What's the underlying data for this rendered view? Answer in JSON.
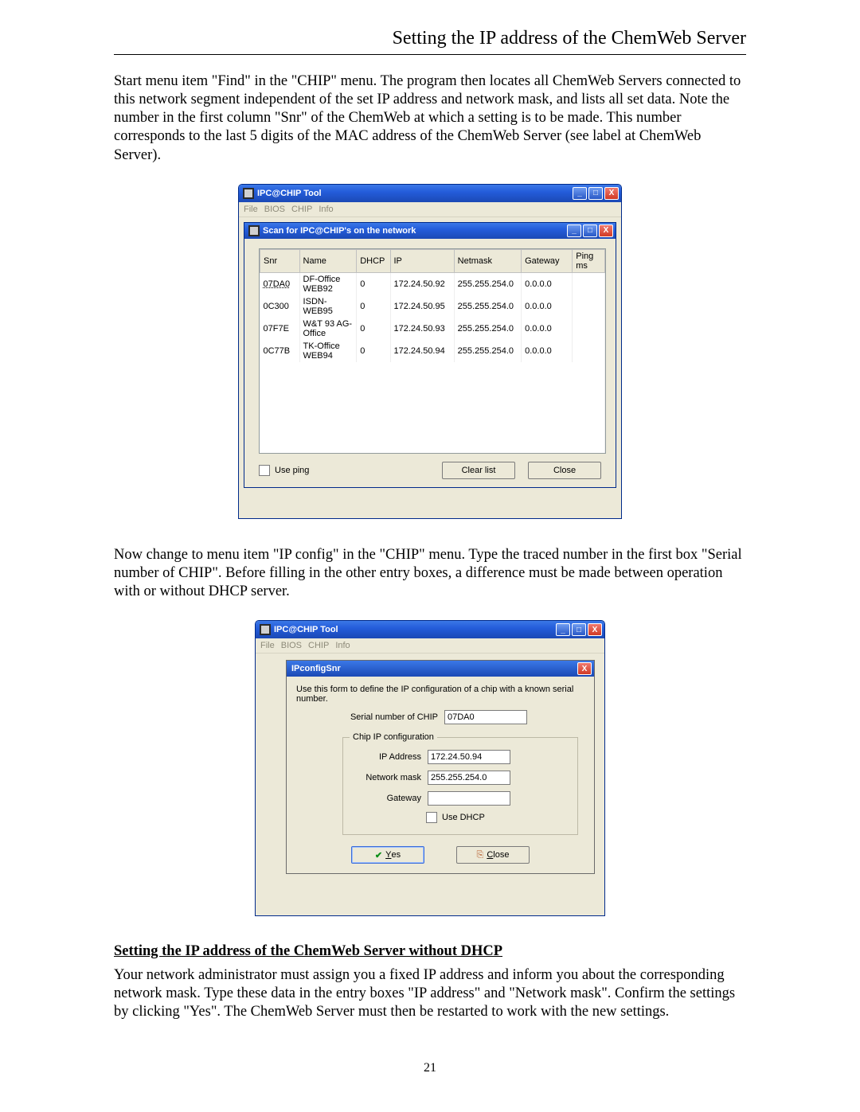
{
  "header": {
    "title": "Setting the IP address of the ChemWeb Server"
  },
  "para1": "Start menu item \"Find\" in the \"CHIP\" menu. The program then locates all ChemWeb Servers connected to this network segment independent of the set IP address and network mask, and lists all set data. Note the number in the first column \"Snr\" of the ChemWeb at which a setting is to be made. This number corresponds to the last 5 digits of the MAC address of the ChemWeb Server (see label at ChemWeb Server).",
  "para2": "Now change to menu item \"IP config\" in the \"CHIP\" menu. Type the traced number in the first box \"Serial number of CHIP\". Before filling in the other entry boxes, a difference must be made between operation with or without DHCP server.",
  "subhead": "Setting the IP address of the ChemWeb Server without DHCP",
  "para3": "Your network administrator must assign you a fixed IP address and inform you about the corresponding network mask. Type these data in the entry boxes \"IP address\" and \"Network mask\". Confirm the settings by clicking \"Yes\". The ChemWeb Server must then be restarted to work with the new settings.",
  "pagenum": "21",
  "tool": {
    "title": "IPC@CHIP Tool",
    "menus": {
      "file": "File",
      "bios": "BIOS",
      "chip": "CHIP",
      "info": "Info"
    }
  },
  "scanwin": {
    "title": "Scan for IPC@CHIP's on the network",
    "headers": {
      "snr": "Snr",
      "name": "Name",
      "dhcp": "DHCP",
      "ip": "IP",
      "netmask": "Netmask",
      "gateway": "Gateway",
      "ping": "Ping ms"
    },
    "rows": [
      {
        "snr": "07DA0",
        "name": "DF-Office WEB92",
        "dhcp": "0",
        "ip": "172.24.50.92",
        "netmask": "255.255.254.0",
        "gateway": "0.0.0.0",
        "ping": ""
      },
      {
        "snr": "0C300",
        "name": "ISDN-WEB95",
        "dhcp": "0",
        "ip": "172.24.50.95",
        "netmask": "255.255.254.0",
        "gateway": "0.0.0.0",
        "ping": ""
      },
      {
        "snr": "07F7E",
        "name": "W&T 93 AG-Office",
        "dhcp": "0",
        "ip": "172.24.50.93",
        "netmask": "255.255.254.0",
        "gateway": "0.0.0.0",
        "ping": ""
      },
      {
        "snr": "0C77B",
        "name": "TK-Office WEB94",
        "dhcp": "0",
        "ip": "172.24.50.94",
        "netmask": "255.255.254.0",
        "gateway": "0.0.0.0",
        "ping": ""
      }
    ],
    "useping": "Use ping",
    "clearlist": "Clear list",
    "close": "Close"
  },
  "ipconfig": {
    "title": "IPconfigSnr",
    "desc": "Use this form to define the IP configuration of a chip with a known serial number.",
    "serial_label": "Serial number of CHIP",
    "serial_value": "07DA0",
    "group": "Chip IP configuration",
    "ip_label": "IP Address",
    "ip_value": "172.24.50.94",
    "mask_label": "Network mask",
    "mask_value": "255.255.254.0",
    "gw_label": "Gateway",
    "gw_value": "",
    "usedhcp": "Use DHCP",
    "yes": "Yes",
    "close": "Close"
  }
}
